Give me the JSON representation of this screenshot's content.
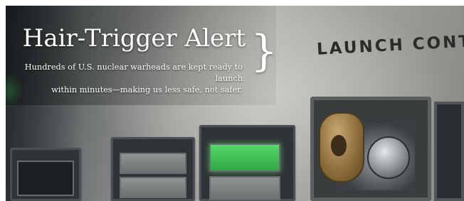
{
  "banner": {
    "title": "Hair-Trigger Alert",
    "subtitle_line1": "Hundreds of U.S. nuclear warheads are kept ready to launch",
    "subtitle_line2": "within minutes—making us less safe, not safer.",
    "brace": "}",
    "photo_label": "LAUNCH CONTRO"
  },
  "colors": {
    "overlay_text": "#ffffff",
    "indicator_green": "#4ccf5f",
    "brass_key": "#a8854e"
  }
}
